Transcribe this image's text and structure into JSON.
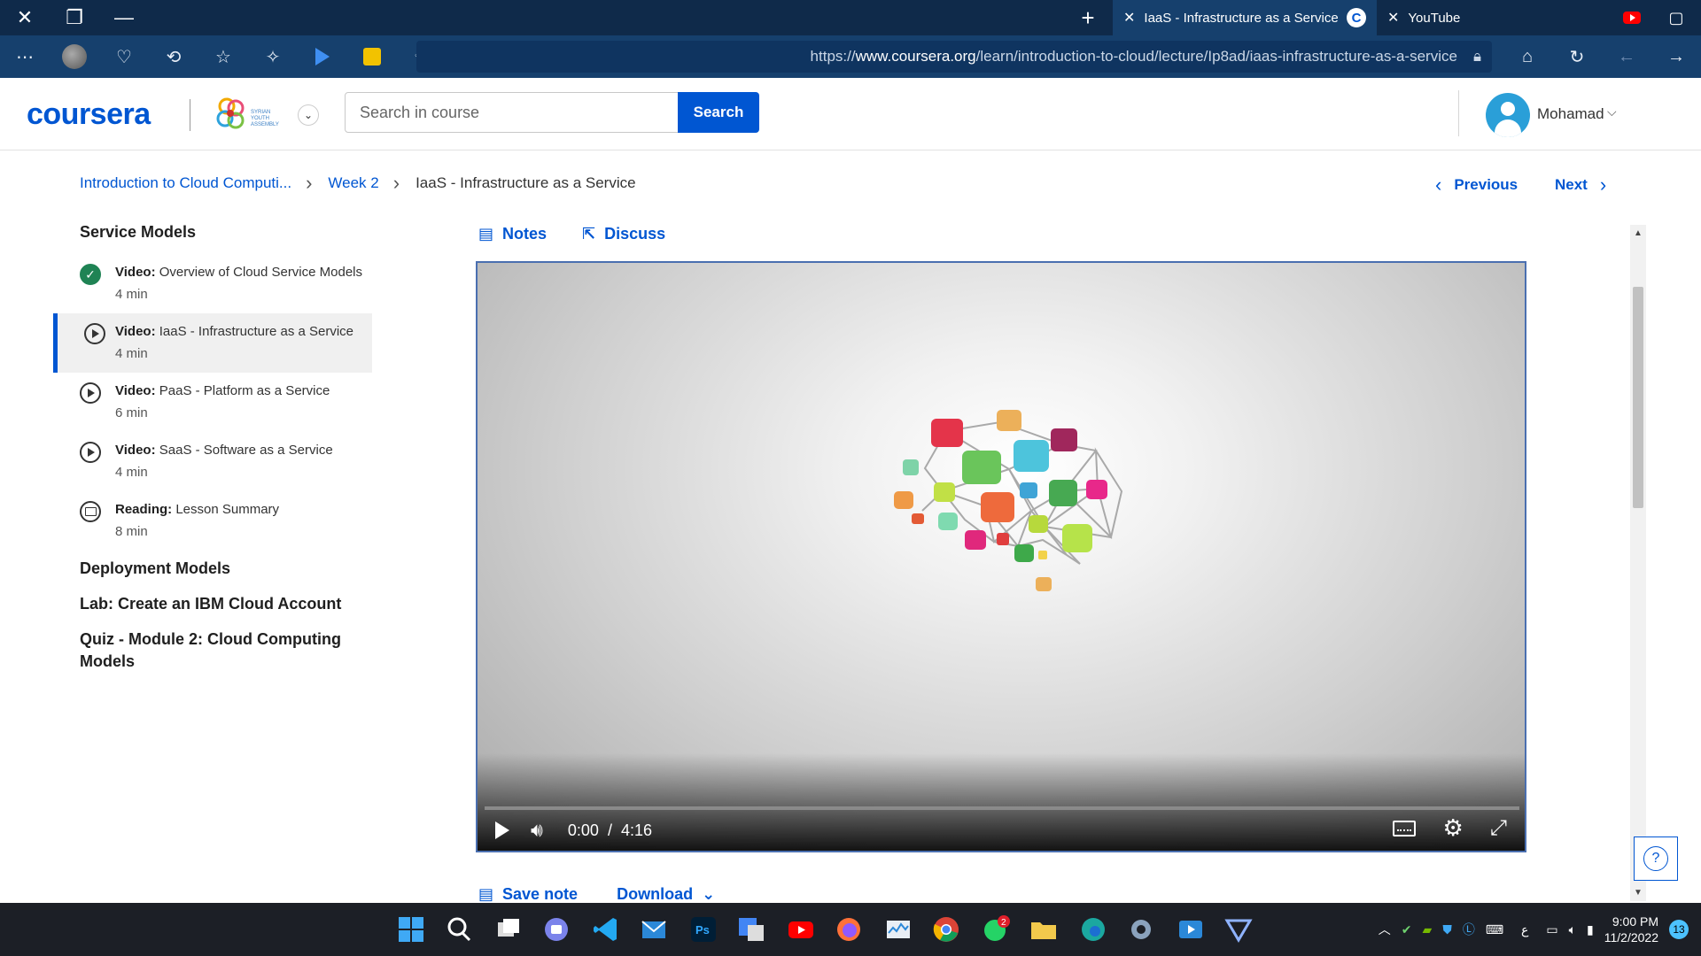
{
  "browser": {
    "tabs": [
      {
        "label": "IaaS - Infrastructure as a Service",
        "icon": "coursera-icon",
        "active": true
      },
      {
        "label": "YouTube",
        "icon": "youtube-icon",
        "active": false
      }
    ],
    "url_prefix": "https://",
    "url_domain": "www.coursera.org",
    "url_path": "/learn/introduction-to-cloud/lecture/Ip8ad/iaas-infrastructure-as-a-service"
  },
  "header": {
    "logo": "coursera",
    "search_placeholder": "Search in course",
    "search_button": "Search",
    "user_name": "Mohamad",
    "partner_text": "SYRIAN YOUTH ASSEMBLY"
  },
  "breadcrumb": {
    "course": "Introduction to Cloud Computi...",
    "week": "Week 2",
    "current": "IaaS - Infrastructure as a Service"
  },
  "nav": {
    "previous": "Previous",
    "next": "Next"
  },
  "sidebar": {
    "section_title": "Service Models",
    "items": [
      {
        "kind": "Video:",
        "title": "Overview of Cloud Service Models",
        "duration": "4 min",
        "status": "done"
      },
      {
        "kind": "Video:",
        "title": "IaaS - Infrastructure as a Service",
        "duration": "4 min",
        "status": "current"
      },
      {
        "kind": "Video:",
        "title": "PaaS - Platform as a Service",
        "duration": "6 min",
        "status": "play"
      },
      {
        "kind": "Video:",
        "title": "SaaS - Software as a Service",
        "duration": "4 min",
        "status": "play"
      },
      {
        "kind": "Reading:",
        "title": "Lesson Summary",
        "duration": "8 min",
        "status": "reading"
      }
    ],
    "other_sections": [
      "Deployment Models",
      "Lab: Create an IBM Cloud Account",
      "Quiz - Module 2: Cloud Computing Models"
    ]
  },
  "main": {
    "notes": "Notes",
    "discuss": "Discuss",
    "video": {
      "current_time": "0:00",
      "separator": "/",
      "duration": "4:16",
      "progress": 0
    },
    "save_note": "Save note",
    "download": "Download"
  },
  "taskbar": {
    "time": "9:00 PM",
    "date": "11/2/2022",
    "notifications": "13",
    "whatsapp_badge": "2",
    "lang": "ع"
  },
  "colors": {
    "accent": "#0056d2",
    "titlebar": "#0f2a4a",
    "toolbar": "#16406d",
    "done_green": "#1f8354"
  }
}
